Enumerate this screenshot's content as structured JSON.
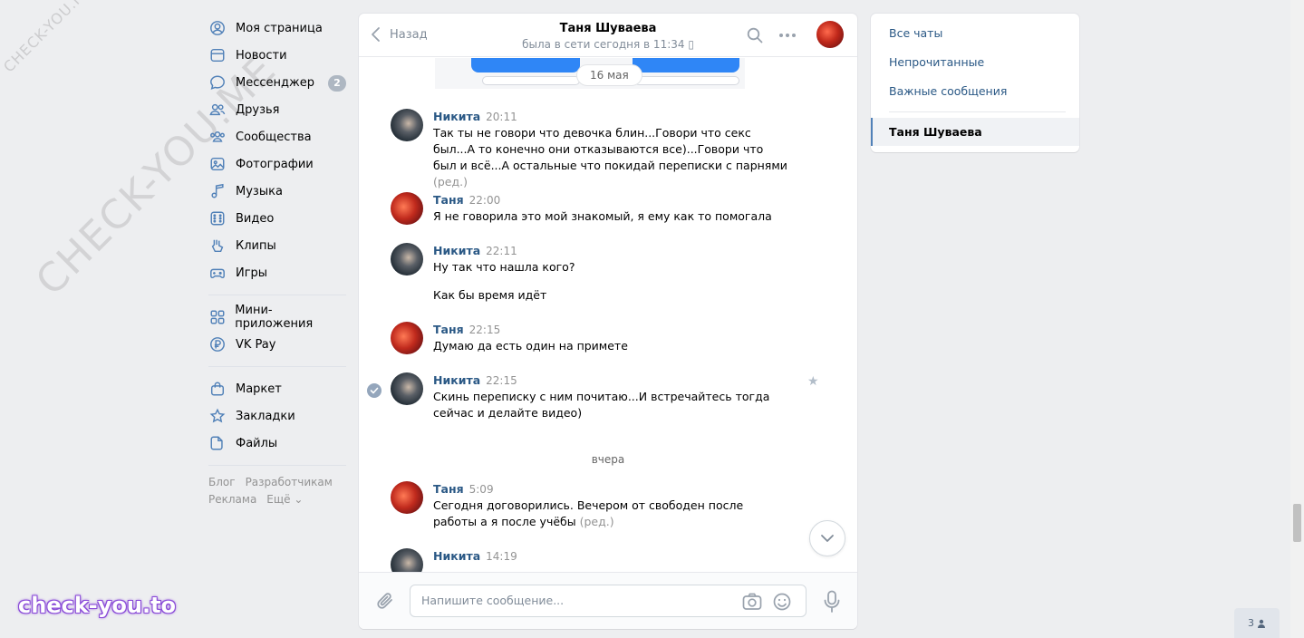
{
  "sidebar": {
    "items": [
      {
        "label": "Моя страница",
        "icon": "user-icon"
      },
      {
        "label": "Новости",
        "icon": "news-icon"
      },
      {
        "label": "Мессенджер",
        "icon": "messenger-icon",
        "badge": "2"
      },
      {
        "label": "Друзья",
        "icon": "friends-icon"
      },
      {
        "label": "Сообщества",
        "icon": "communities-icon"
      },
      {
        "label": "Фотографии",
        "icon": "photos-icon"
      },
      {
        "label": "Музыка",
        "icon": "music-icon"
      },
      {
        "label": "Видео",
        "icon": "video-icon"
      },
      {
        "label": "Клипы",
        "icon": "clips-icon"
      },
      {
        "label": "Игры",
        "icon": "games-icon"
      },
      {
        "label": "Мини-приложения",
        "icon": "mini-apps-icon"
      },
      {
        "label": "VK Pay",
        "icon": "vkpay-icon"
      },
      {
        "label": "Маркет",
        "icon": "market-icon"
      },
      {
        "label": "Закладки",
        "icon": "bookmarks-icon"
      },
      {
        "label": "Файлы",
        "icon": "files-icon"
      }
    ],
    "footer": {
      "blog": "Блог",
      "developers": "Разработчикам",
      "ads": "Реклама",
      "more": "Ещё ⌄"
    }
  },
  "chat": {
    "back_label": "Назад",
    "contact_name": "Таня Шуваева",
    "status": "была в сети сегодня в 11:34 ▯",
    "date_pill": "16 мая",
    "day_separator": "вчера",
    "messages": [
      {
        "author": "Никита",
        "time": "20:11",
        "text": "Так ты не говори что девочка блин...Говори что секс был...А то конечно они отказываются все)...Говори что был и всё...А остальные что покидай переписки с парнями",
        "edited": "(ред.)"
      },
      {
        "author": "Таня",
        "time": "22:00",
        "text": "Я не говорила это мой знакомый, я ему как то помогала"
      },
      {
        "author": "Никита",
        "time": "22:11",
        "text": "Ну так что нашла кого?",
        "text2": "Как бы время идёт"
      },
      {
        "author": "Таня",
        "time": "22:15",
        "text": "Думаю да есть один на примете"
      },
      {
        "author": "Никита",
        "time": "22:15",
        "text": "Скинь переписку с ним почитаю...И встречайтесь тогда сейчас и делайте видео)"
      },
      {
        "author": "Таня",
        "time": "5:09",
        "text": "Сегодня договорились. Вечером от свободен после работы а я после учёбы",
        "edited": "(ред.)"
      },
      {
        "author": "Никита",
        "time": "14:19",
        "text": ""
      }
    ],
    "composer_placeholder": "Напишите сообщение..."
  },
  "right_menu": {
    "all_chats": "Все чаты",
    "unread": "Непрочитанные",
    "important": "Важные сообщения",
    "active_chat": "Таня Шуваева"
  },
  "corner_counter": "3",
  "watermarks": {
    "small": "CHECK-YOU.ME",
    "large": "CHECK-YOU.ME",
    "logo": "check-you.to"
  },
  "colors": {
    "link": "#2a5885",
    "accent": "#5181b8",
    "background": "#edeef0"
  }
}
